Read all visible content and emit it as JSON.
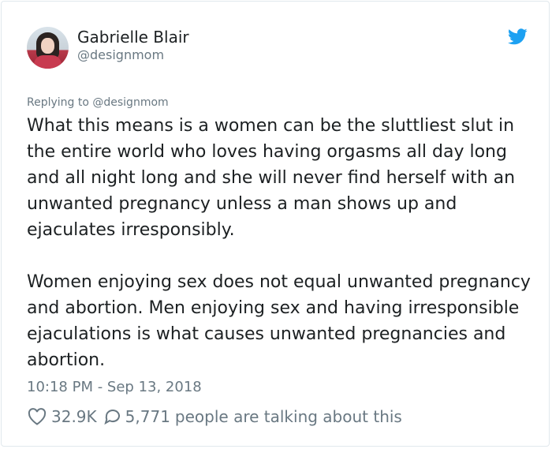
{
  "tweet": {
    "author_name": "Gabrielle Blair",
    "author_handle": "@designmom",
    "reply_context": "Replying to @designmom",
    "paragraphs": [
      "What this means is a women can be the sluttliest slut in the entire world who loves having orgasms all day long and all night long and she will never find herself with an unwanted pregnancy unless a man shows up and ejaculates irresponsibly.",
      "Women enjoying sex does not equal unwanted pregnancy and abortion. Men enjoying sex and having irresponsible ejaculations is what causes unwanted pregnancies and abortion."
    ],
    "timestamp": "10:18 PM - Sep 13, 2018",
    "like_count": "32.9K",
    "conversation_count": "5,771",
    "conversation_suffix": "people are talking about this"
  },
  "icons": {
    "brand": "twitter-bird-icon",
    "like": "heart-icon",
    "reply": "speech-bubble-icon"
  },
  "colors": {
    "text": "#1c2022",
    "muted": "#697882",
    "twitter_blue": "#1da1f2",
    "border": "#e1e8ed"
  }
}
